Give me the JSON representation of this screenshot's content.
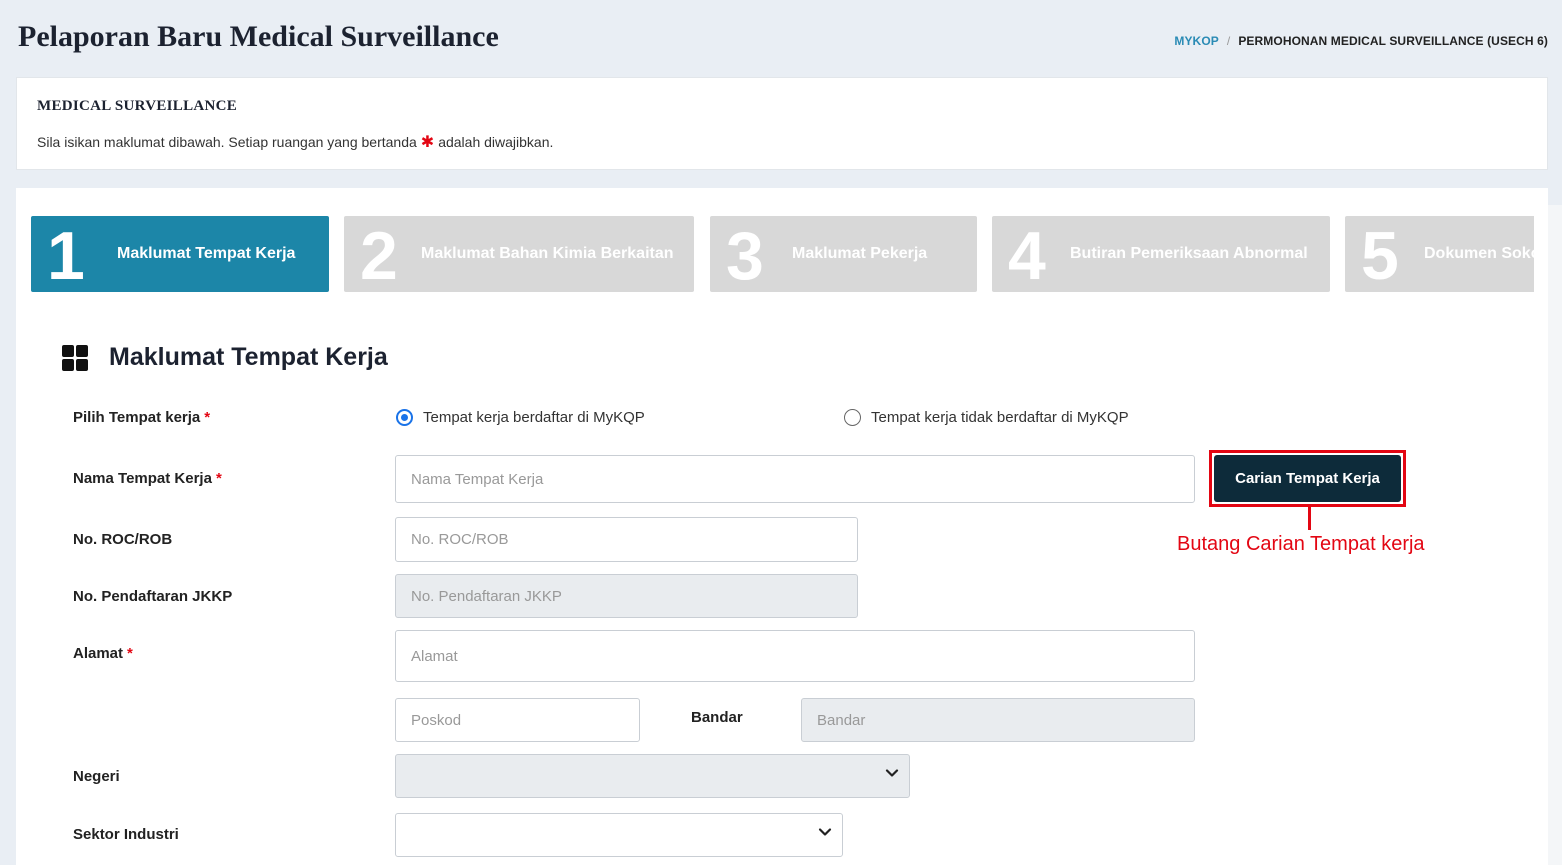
{
  "header": {
    "title": "Pelaporan Baru Medical Surveillance",
    "breadcrumb": {
      "home": "MYKOP",
      "separator": "/",
      "current": "PERMOHONAN MEDICAL SURVEILLANCE (USECH 6)"
    }
  },
  "info": {
    "title": "MEDICAL SURVEILLANCE",
    "text_before": "Sila isikan maklumat dibawah. Setiap ruangan yang bertanda",
    "star": "✱",
    "text_after": "adalah diwajibkan."
  },
  "steps": [
    {
      "num": "1",
      "label": "Maklumat Tempat Kerja",
      "active": true
    },
    {
      "num": "2",
      "label": "Maklumat Bahan Kimia Berkaitan",
      "active": false
    },
    {
      "num": "3",
      "label": "Maklumat Pekerja",
      "active": false
    },
    {
      "num": "4",
      "label": "Butiran Pemeriksaan Abnormal",
      "active": false
    },
    {
      "num": "5",
      "label": "Dokumen Sokongan",
      "active": false
    }
  ],
  "section": {
    "title": "Maklumat Tempat Kerja",
    "icon": "grid-icon"
  },
  "form": {
    "required_mark": "*",
    "pilih": {
      "label": "Pilih Tempat kerja",
      "option_registered": "Tempat kerja berdaftar di MyKQP",
      "option_unregistered": "Tempat kerja tidak berdaftar di MyKQP",
      "selected": "registered"
    },
    "nama": {
      "label": "Nama Tempat Kerja",
      "placeholder": "Nama Tempat Kerja",
      "value": ""
    },
    "search_button": "Carian Tempat Kerja",
    "roc": {
      "label": "No. ROC/ROB",
      "placeholder": "No. ROC/ROB",
      "value": ""
    },
    "jkkp": {
      "label": "No. Pendaftaran JKKP",
      "placeholder": "No. Pendaftaran JKKP",
      "value": ""
    },
    "alamat": {
      "label": "Alamat",
      "placeholder": "Alamat",
      "value": ""
    },
    "poskod": {
      "placeholder": "Poskod",
      "value": ""
    },
    "bandar": {
      "label": "Bandar",
      "placeholder": "Bandar",
      "value": ""
    },
    "negeri": {
      "label": "Negeri",
      "value": ""
    },
    "sektor": {
      "label": "Sektor Industri",
      "value": ""
    }
  },
  "annotation": {
    "text": "Butang Carian Tempat kerja",
    "color": "#e30613"
  },
  "colors": {
    "accent": "#1c86a8",
    "button_dark": "#0d2b3a",
    "required": "#e30613",
    "radio": "#1a73e8"
  }
}
